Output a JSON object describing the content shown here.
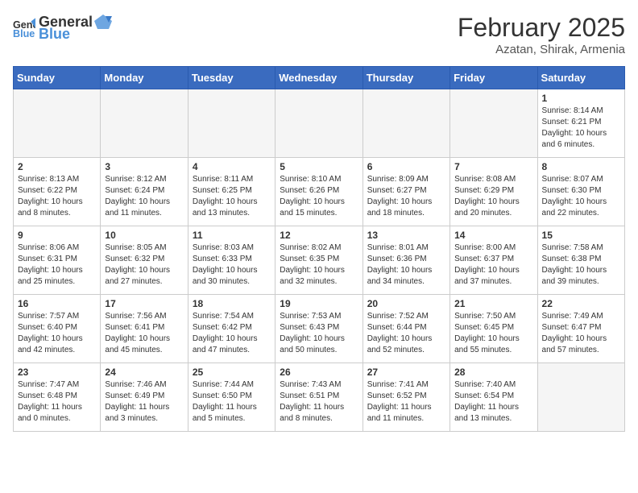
{
  "logo": {
    "text_general": "General",
    "text_blue": "Blue"
  },
  "title": "February 2025",
  "subtitle": "Azatan, Shirak, Armenia",
  "days_of_week": [
    "Sunday",
    "Monday",
    "Tuesday",
    "Wednesday",
    "Thursday",
    "Friday",
    "Saturday"
  ],
  "weeks": [
    [
      {
        "day": "",
        "empty": true
      },
      {
        "day": "",
        "empty": true
      },
      {
        "day": "",
        "empty": true
      },
      {
        "day": "",
        "empty": true
      },
      {
        "day": "",
        "empty": true
      },
      {
        "day": "",
        "empty": true
      },
      {
        "day": "1",
        "sunrise": "Sunrise: 8:14 AM",
        "sunset": "Sunset: 6:21 PM",
        "daylight": "Daylight: 10 hours and 6 minutes."
      }
    ],
    [
      {
        "day": "2",
        "sunrise": "Sunrise: 8:13 AM",
        "sunset": "Sunset: 6:22 PM",
        "daylight": "Daylight: 10 hours and 8 minutes."
      },
      {
        "day": "3",
        "sunrise": "Sunrise: 8:12 AM",
        "sunset": "Sunset: 6:24 PM",
        "daylight": "Daylight: 10 hours and 11 minutes."
      },
      {
        "day": "4",
        "sunrise": "Sunrise: 8:11 AM",
        "sunset": "Sunset: 6:25 PM",
        "daylight": "Daylight: 10 hours and 13 minutes."
      },
      {
        "day": "5",
        "sunrise": "Sunrise: 8:10 AM",
        "sunset": "Sunset: 6:26 PM",
        "daylight": "Daylight: 10 hours and 15 minutes."
      },
      {
        "day": "6",
        "sunrise": "Sunrise: 8:09 AM",
        "sunset": "Sunset: 6:27 PM",
        "daylight": "Daylight: 10 hours and 18 minutes."
      },
      {
        "day": "7",
        "sunrise": "Sunrise: 8:08 AM",
        "sunset": "Sunset: 6:29 PM",
        "daylight": "Daylight: 10 hours and 20 minutes."
      },
      {
        "day": "8",
        "sunrise": "Sunrise: 8:07 AM",
        "sunset": "Sunset: 6:30 PM",
        "daylight": "Daylight: 10 hours and 22 minutes."
      }
    ],
    [
      {
        "day": "9",
        "sunrise": "Sunrise: 8:06 AM",
        "sunset": "Sunset: 6:31 PM",
        "daylight": "Daylight: 10 hours and 25 minutes."
      },
      {
        "day": "10",
        "sunrise": "Sunrise: 8:05 AM",
        "sunset": "Sunset: 6:32 PM",
        "daylight": "Daylight: 10 hours and 27 minutes."
      },
      {
        "day": "11",
        "sunrise": "Sunrise: 8:03 AM",
        "sunset": "Sunset: 6:33 PM",
        "daylight": "Daylight: 10 hours and 30 minutes."
      },
      {
        "day": "12",
        "sunrise": "Sunrise: 8:02 AM",
        "sunset": "Sunset: 6:35 PM",
        "daylight": "Daylight: 10 hours and 32 minutes."
      },
      {
        "day": "13",
        "sunrise": "Sunrise: 8:01 AM",
        "sunset": "Sunset: 6:36 PM",
        "daylight": "Daylight: 10 hours and 34 minutes."
      },
      {
        "day": "14",
        "sunrise": "Sunrise: 8:00 AM",
        "sunset": "Sunset: 6:37 PM",
        "daylight": "Daylight: 10 hours and 37 minutes."
      },
      {
        "day": "15",
        "sunrise": "Sunrise: 7:58 AM",
        "sunset": "Sunset: 6:38 PM",
        "daylight": "Daylight: 10 hours and 39 minutes."
      }
    ],
    [
      {
        "day": "16",
        "sunrise": "Sunrise: 7:57 AM",
        "sunset": "Sunset: 6:40 PM",
        "daylight": "Daylight: 10 hours and 42 minutes."
      },
      {
        "day": "17",
        "sunrise": "Sunrise: 7:56 AM",
        "sunset": "Sunset: 6:41 PM",
        "daylight": "Daylight: 10 hours and 45 minutes."
      },
      {
        "day": "18",
        "sunrise": "Sunrise: 7:54 AM",
        "sunset": "Sunset: 6:42 PM",
        "daylight": "Daylight: 10 hours and 47 minutes."
      },
      {
        "day": "19",
        "sunrise": "Sunrise: 7:53 AM",
        "sunset": "Sunset: 6:43 PM",
        "daylight": "Daylight: 10 hours and 50 minutes."
      },
      {
        "day": "20",
        "sunrise": "Sunrise: 7:52 AM",
        "sunset": "Sunset: 6:44 PM",
        "daylight": "Daylight: 10 hours and 52 minutes."
      },
      {
        "day": "21",
        "sunrise": "Sunrise: 7:50 AM",
        "sunset": "Sunset: 6:45 PM",
        "daylight": "Daylight: 10 hours and 55 minutes."
      },
      {
        "day": "22",
        "sunrise": "Sunrise: 7:49 AM",
        "sunset": "Sunset: 6:47 PM",
        "daylight": "Daylight: 10 hours and 57 minutes."
      }
    ],
    [
      {
        "day": "23",
        "sunrise": "Sunrise: 7:47 AM",
        "sunset": "Sunset: 6:48 PM",
        "daylight": "Daylight: 11 hours and 0 minutes."
      },
      {
        "day": "24",
        "sunrise": "Sunrise: 7:46 AM",
        "sunset": "Sunset: 6:49 PM",
        "daylight": "Daylight: 11 hours and 3 minutes."
      },
      {
        "day": "25",
        "sunrise": "Sunrise: 7:44 AM",
        "sunset": "Sunset: 6:50 PM",
        "daylight": "Daylight: 11 hours and 5 minutes."
      },
      {
        "day": "26",
        "sunrise": "Sunrise: 7:43 AM",
        "sunset": "Sunset: 6:51 PM",
        "daylight": "Daylight: 11 hours and 8 minutes."
      },
      {
        "day": "27",
        "sunrise": "Sunrise: 7:41 AM",
        "sunset": "Sunset: 6:52 PM",
        "daylight": "Daylight: 11 hours and 11 minutes."
      },
      {
        "day": "28",
        "sunrise": "Sunrise: 7:40 AM",
        "sunset": "Sunset: 6:54 PM",
        "daylight": "Daylight: 11 hours and 13 minutes."
      },
      {
        "day": "",
        "empty": true
      }
    ]
  ]
}
